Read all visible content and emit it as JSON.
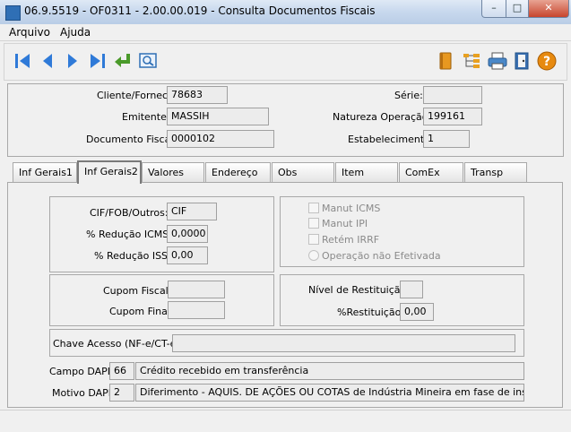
{
  "window": {
    "title": "06.9.5519 - OF0311 - 2.00.00.019 - Consulta Documentos Fiscais",
    "min": "–",
    "max": "□",
    "close": "✕"
  },
  "menu": [
    "Arquivo",
    "Ajuda"
  ],
  "toolbar_icons": {
    "first": "first-record-icon",
    "prev": "previous-record-icon",
    "next": "next-record-icon",
    "last": "last-record-icon",
    "enter": "return-icon",
    "view": "view-icon",
    "book": "book-icon",
    "tree": "tree-icon",
    "print": "print-icon",
    "exit": "exit-door-icon",
    "help": "help-icon"
  },
  "colors": {
    "nav_blue": "#2f7ad8",
    "enter_green": "#4a9a2a",
    "help_orange": "#e78a10",
    "book_orange": "#e89820"
  },
  "header": {
    "cliente_label": "Cliente/Fornec:",
    "cliente_value": "78683",
    "emitente_label": "Emitente:",
    "emitente_value": "MASSIH",
    "documento_label": "Documento Fiscal:",
    "documento_value": "0000102",
    "serie_label": "Série:",
    "serie_value": "",
    "natureza_label": "Natureza Operação:",
    "natureza_value": "199161",
    "estab_label": "Estabelecimento:",
    "estab_value": "1"
  },
  "tabs": [
    "Inf Gerais1",
    "Inf Gerais2",
    "Valores",
    "Endereço",
    "Obs",
    "Item",
    "ComEx",
    "Transp"
  ],
  "active_tab": "Inf Gerais2",
  "panel": {
    "cif_label": "CIF/FOB/Outros:",
    "cif_value": "CIF",
    "red_icms_label": "% Redução ICMS:",
    "red_icms_value": "0,0000",
    "red_iss_label": "% Redução ISS:",
    "red_iss_value": "0,00",
    "manut_icms": "Manut ICMS",
    "manut_ipi": "Manut IPI",
    "retem_irrf": "Retém IRRF",
    "operacao_nao_efetivada": "Operação não Efetivada",
    "cupom_fiscal_label": "Cupom Fiscal",
    "cupom_fiscal_value": "",
    "cupom_final_label": "Cupom Final:",
    "cupom_final_value": "",
    "nivel_rest_label": "Nível de Restituição:",
    "nivel_rest_value": "",
    "pct_rest_label": "%Restituição:",
    "pct_rest_value": "0,00",
    "chave_label": "Chave Acesso (NF-e/CT-e):",
    "chave_value": "",
    "campo_dapi_label": "Campo DAPI:",
    "campo_dapi_code": "66",
    "campo_dapi_desc": "Crédito recebido em transferência",
    "motivo_dapi_label": "Motivo DAPI:",
    "motivo_dapi_code": "2",
    "motivo_dapi_desc": "Diferimento - AQUIS. DE AÇÕES OU COTAS de Indústria Mineira em fase de instalação/ex"
  }
}
